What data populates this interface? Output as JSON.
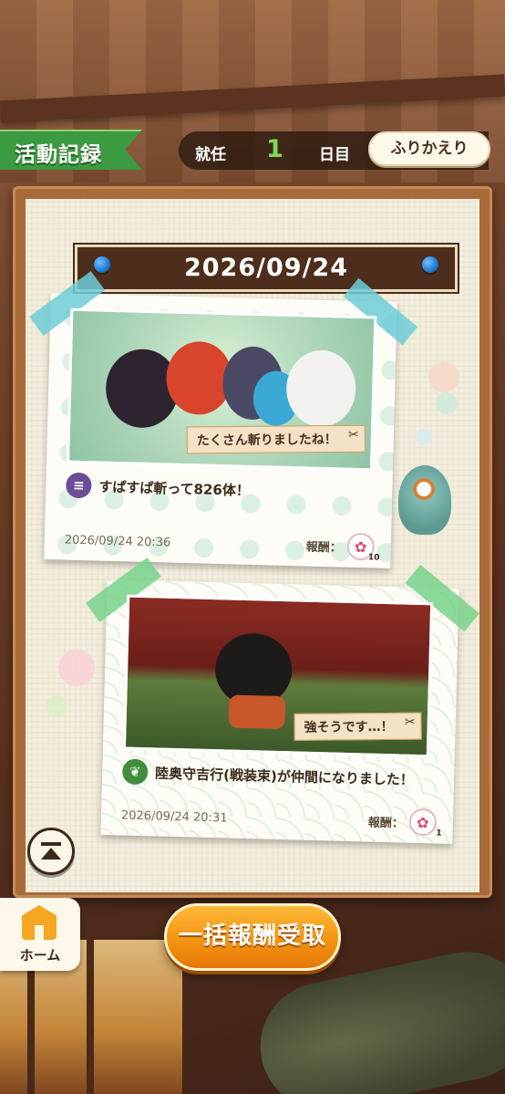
{
  "header": {
    "title": "活動記録",
    "day_prefix": "就任",
    "day_number": "1",
    "day_suffix": "日目",
    "review_button": "ふりかえり"
  },
  "board": {
    "date": "2026/09/24"
  },
  "records": [
    {
      "caption": "たくさん斬りましたね！",
      "description": "すぱすぱ斬って826体！",
      "timestamp": "2026/09/24 20:36",
      "reward_label": "報酬：",
      "reward_count": "10",
      "icon": "enemy-icon",
      "accent": "#6b4c9a"
    },
    {
      "caption": "強そうです…！",
      "description": "陸奥守吉行(戦装束)が仲間になりました！",
      "timestamp": "2026/09/24 20:31",
      "reward_label": "報酬：",
      "reward_count": "1",
      "icon": "sprout-icon",
      "accent": "#3f8e3e"
    }
  ],
  "footer": {
    "home_label": "ホーム",
    "claim_button": "一括報酬受取"
  },
  "colors": {
    "title_green": "#3c9a41",
    "claim_orange": "#f39412",
    "day_green": "#7ed957"
  }
}
